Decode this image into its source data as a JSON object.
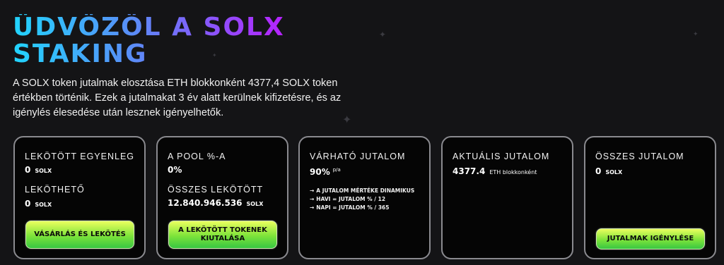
{
  "header": {
    "title_line1": "ÜDVÖZÖL A SOLX",
    "title_line2": "STAKING",
    "intro": "A SOLX token jutalmak elosztása ETH blokkonként 4377,4 SOLX token értékben történik. Ezek a jutalmakat 3 év alatt kerülnek kifizetésre, és az igénylés élesedése után lesznek igényelhetők."
  },
  "cards": {
    "balance": {
      "staked_label": "LEKÖTÖTT EGYENLEG",
      "staked_value": "0",
      "staked_unit": "SOLX",
      "stakeable_label": "LEKÖTHETŐ",
      "stakeable_value": "0",
      "stakeable_unit": "SOLX",
      "button": "VÁSÁRLÁS ÉS LEKÖTÉS"
    },
    "pool": {
      "share_label": "A POOL %-A",
      "share_value": "0%",
      "total_label": "ÖSSZES LEKÖTÖTT",
      "total_value": "12.840.946.536",
      "total_unit": "SOLX",
      "button": "A LEKÖTÖTT TOKENEK KIUTALÁSA"
    },
    "expected": {
      "label": "VÁRHATÓ JUTALOM",
      "value": "90%",
      "period": "p/a",
      "notes": [
        "A JUTALOM MÉRTÉKE DINAMIKUS",
        "HAVI = JUTALOM % / 12",
        "NAPI = JUTALOM % / 365"
      ],
      "arrow": "→"
    },
    "current": {
      "label": "AKTUÁLIS JUTALOM",
      "value": "4377.4",
      "unit": "ETH blokkonként"
    },
    "total": {
      "label": "ÖSSZES JUTALOM",
      "value": "0",
      "unit": "SOLX",
      "button": "JUTALMAK IGÉNYLÉSE"
    }
  },
  "colors": {
    "title_gradient": [
      "#21d4fd",
      "#5b8bf7",
      "#b721ff"
    ],
    "button_gradient": [
      "#eaff5e",
      "#7de33a",
      "#38c742"
    ],
    "card_border": "#8a8a8f",
    "background": "#141416"
  },
  "icons": {
    "decor": "sparkle-star"
  }
}
